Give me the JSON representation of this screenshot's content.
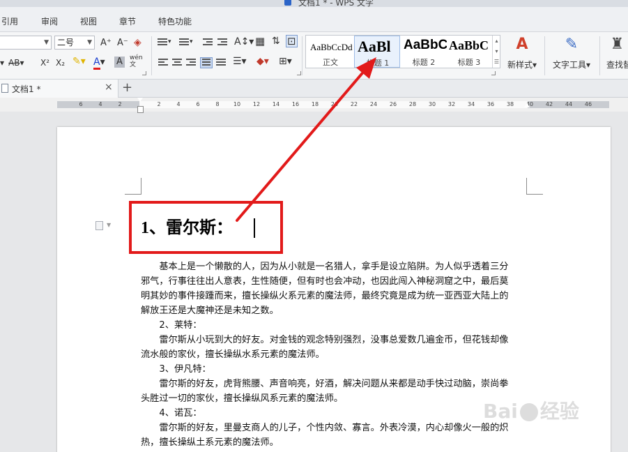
{
  "window": {
    "title": "文档1 * - WPS 文字"
  },
  "menu": {
    "items": [
      "引用",
      "审阅",
      "视图",
      "章节",
      "特色功能"
    ]
  },
  "ribbon": {
    "font_size": "二号",
    "font_grow": "A⁺",
    "font_shrink": "A⁻",
    "bold_label": "B",
    "strike_label": "AB",
    "superscript": "X²",
    "subscript": "X₂",
    "font_color_label": "A",
    "char_shade_label": "A",
    "phonetic_label": "wén",
    "styles": [
      {
        "sample": "AaBbCcDd",
        "name": "正文"
      },
      {
        "sample": "AaBl",
        "name": "标题 1"
      },
      {
        "sample": "AaBbC",
        "name": "标题 2"
      },
      {
        "sample": "AaBbC",
        "name": "标题 3"
      }
    ],
    "new_style": "新样式",
    "text_tools": "文字工具",
    "find_replace": "查找替"
  },
  "tabs": {
    "doc_name": "文档1 *",
    "close": "×",
    "new_tab": "+"
  },
  "ruler": {
    "numbers": [
      "6",
      "4",
      "2",
      "2",
      "4",
      "6",
      "8",
      "10",
      "12",
      "14",
      "16",
      "18",
      "20",
      "22",
      "24",
      "26",
      "28",
      "30",
      "32",
      "34",
      "36",
      "38",
      "40",
      "42",
      "44",
      "46"
    ]
  },
  "document": {
    "heading": "1、雷尔斯：",
    "lines": [
      "　　基本上是一个懒散的人，因为从小就是一名猎人，拿手是设立陷阱。为人似乎透着三分",
      "邪气，行事往往出人意表，生性随便，但有时也会冲动，也因此闯入神秘洞窟之中，最后莫",
      "明其妙的事件接踵而来，擅长操纵火系元素的魔法师，最终究竟是成为统一亚西亚大陆上的",
      "解放王还是大魔神还是未知之数。",
      "　　2、莱特：",
      "　　雷尔斯从小玩到大的好友。对金钱的观念特别强烈，没事总爱数几遍金币，但花钱却像",
      "流水般的家伙，擅长操纵水系元素的魔法师。",
      "　　3、伊凡特：",
      "　　雷尔斯的好友，虎背熊腰、声音响亮，好酒，解决问题从来都是动手快过动脑，崇尚拳",
      "头胜过一切的家伙，擅长操纵风系元素的魔法师。",
      "　　4、诺瓦：",
      "　　雷尔斯的好友，里曼支商人的儿子，个性内敛、寡言。外表冷漠，内心却像火一般的炽",
      "热，擅长操纵土系元素的魔法师。"
    ]
  },
  "watermark": {
    "left": "Bai",
    "right": "经验"
  },
  "annotation": {
    "color": "#e21a1a"
  }
}
